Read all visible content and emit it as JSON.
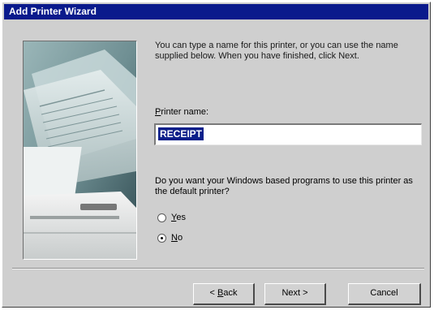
{
  "window": {
    "title": "Add Printer Wizard"
  },
  "instructions": "You can type a name for this printer, or you can use the name supplied below. When you have finished, click Next.",
  "printer_name": {
    "label_prefix": "",
    "label_accel": "P",
    "label_rest": "rinter name:",
    "value": "RECEIPT"
  },
  "default_question": "Do you want your Windows based programs to use this printer as the default printer?",
  "options": [
    {
      "accel": "Y",
      "rest": "es",
      "selected": false
    },
    {
      "accel": "N",
      "rest": "o",
      "selected": true
    }
  ],
  "buttons": {
    "back_prefix": "< ",
    "back_accel": "B",
    "back_rest": "ack",
    "next": "Next >",
    "cancel": "Cancel"
  },
  "colors": {
    "title_bar": "#0a1a8c",
    "dialog_face": "#cfcfcf",
    "selection": "#0b1f8a"
  }
}
